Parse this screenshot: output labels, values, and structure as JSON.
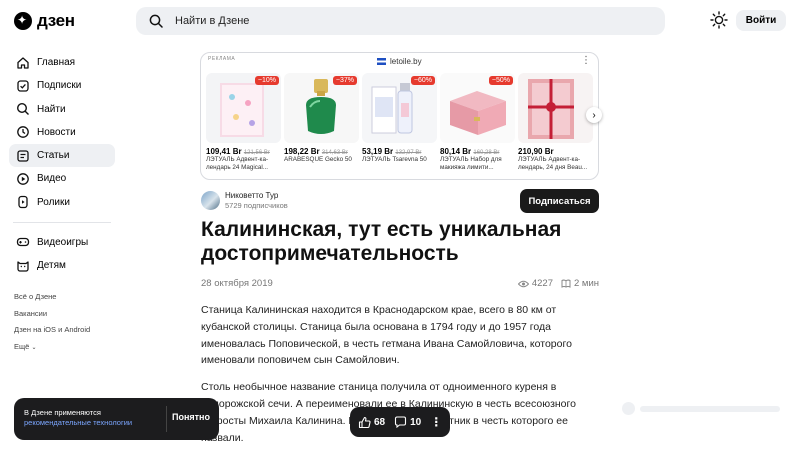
{
  "header": {
    "logo_text": "дзен",
    "search_placeholder": "Найти в Дзене",
    "login_label": "Войти"
  },
  "sidebar": {
    "items": [
      {
        "label": "Главная",
        "icon": "home-icon"
      },
      {
        "label": "Подписки",
        "icon": "subscriptions-icon"
      },
      {
        "label": "Найти",
        "icon": "search-icon"
      },
      {
        "label": "Новости",
        "icon": "news-icon"
      },
      {
        "label": "Статьи",
        "icon": "articles-icon",
        "active": true
      },
      {
        "label": "Видео",
        "icon": "video-icon"
      },
      {
        "label": "Ролики",
        "icon": "shorts-icon"
      }
    ],
    "items2": [
      {
        "label": "Видеоигры",
        "icon": "gamepad-icon"
      },
      {
        "label": "Детям",
        "icon": "kids-icon"
      }
    ],
    "footer": [
      "Всё о Дзене",
      "Вакансии",
      "Дзен на iOS и Android",
      "Ещё"
    ]
  },
  "ad": {
    "label": "РЕКЛАМА",
    "store": "letoile.by",
    "products": [
      {
        "price": "109,41 Br",
        "old": "121,56 Br",
        "badge": "−10%",
        "name": "ЛЭТУАЛЬ Адвент-ка-лендарь 24 Magical..."
      },
      {
        "price": "198,22 Br",
        "old": "314,63 Br",
        "badge": "−37%",
        "name": "ARABESQUE Gecko 50"
      },
      {
        "price": "53,19 Br",
        "old": "132,97 Br",
        "badge": "−60%",
        "name": "ЛЭТУАЛЬ Tsarevna 50"
      },
      {
        "price": "80,14 Br",
        "old": "160,28 Br",
        "badge": "−50%",
        "name": "ЛЭТУАЛЬ Набор для макияжа лимити..."
      },
      {
        "price": "210,90 Br",
        "old": "",
        "badge": "",
        "name": "ЛЭТУАЛЬ Адвент-ка-лендарь, 24 дня Beau..."
      }
    ]
  },
  "article": {
    "author": "Никоветто Тур",
    "subscribers": "5729 подписчиков",
    "subscribe_label": "Подписаться",
    "title": "Калининская, тут есть уникальная достопримечательность",
    "date": "28 октября 2019",
    "views": "4227",
    "read_time": "2 мин",
    "paragraphs": [
      "Станица Калининская находится в Краснодарском крае, всего в 80 км от кубанской столицы. Станица была основана в 1794 году и до 1957 года именовалась Поповической, в честь гетмана Ивана Самойловича, которого именовали поповичем сын Самойлович.",
      "Столь необычное название станица получила от одноименного куреня в Запорожской сечи. А переименовали ее в Калининскую в честь всесоюзного старосты Михаила Калинина. В станице есть памятник в честь которого ее назвали."
    ]
  },
  "cookie": {
    "text": "В Дзене применяются",
    "link": "рекомендательные технологии",
    "button": "Понятно"
  },
  "reactions": {
    "likes": "68",
    "comments": "10"
  }
}
